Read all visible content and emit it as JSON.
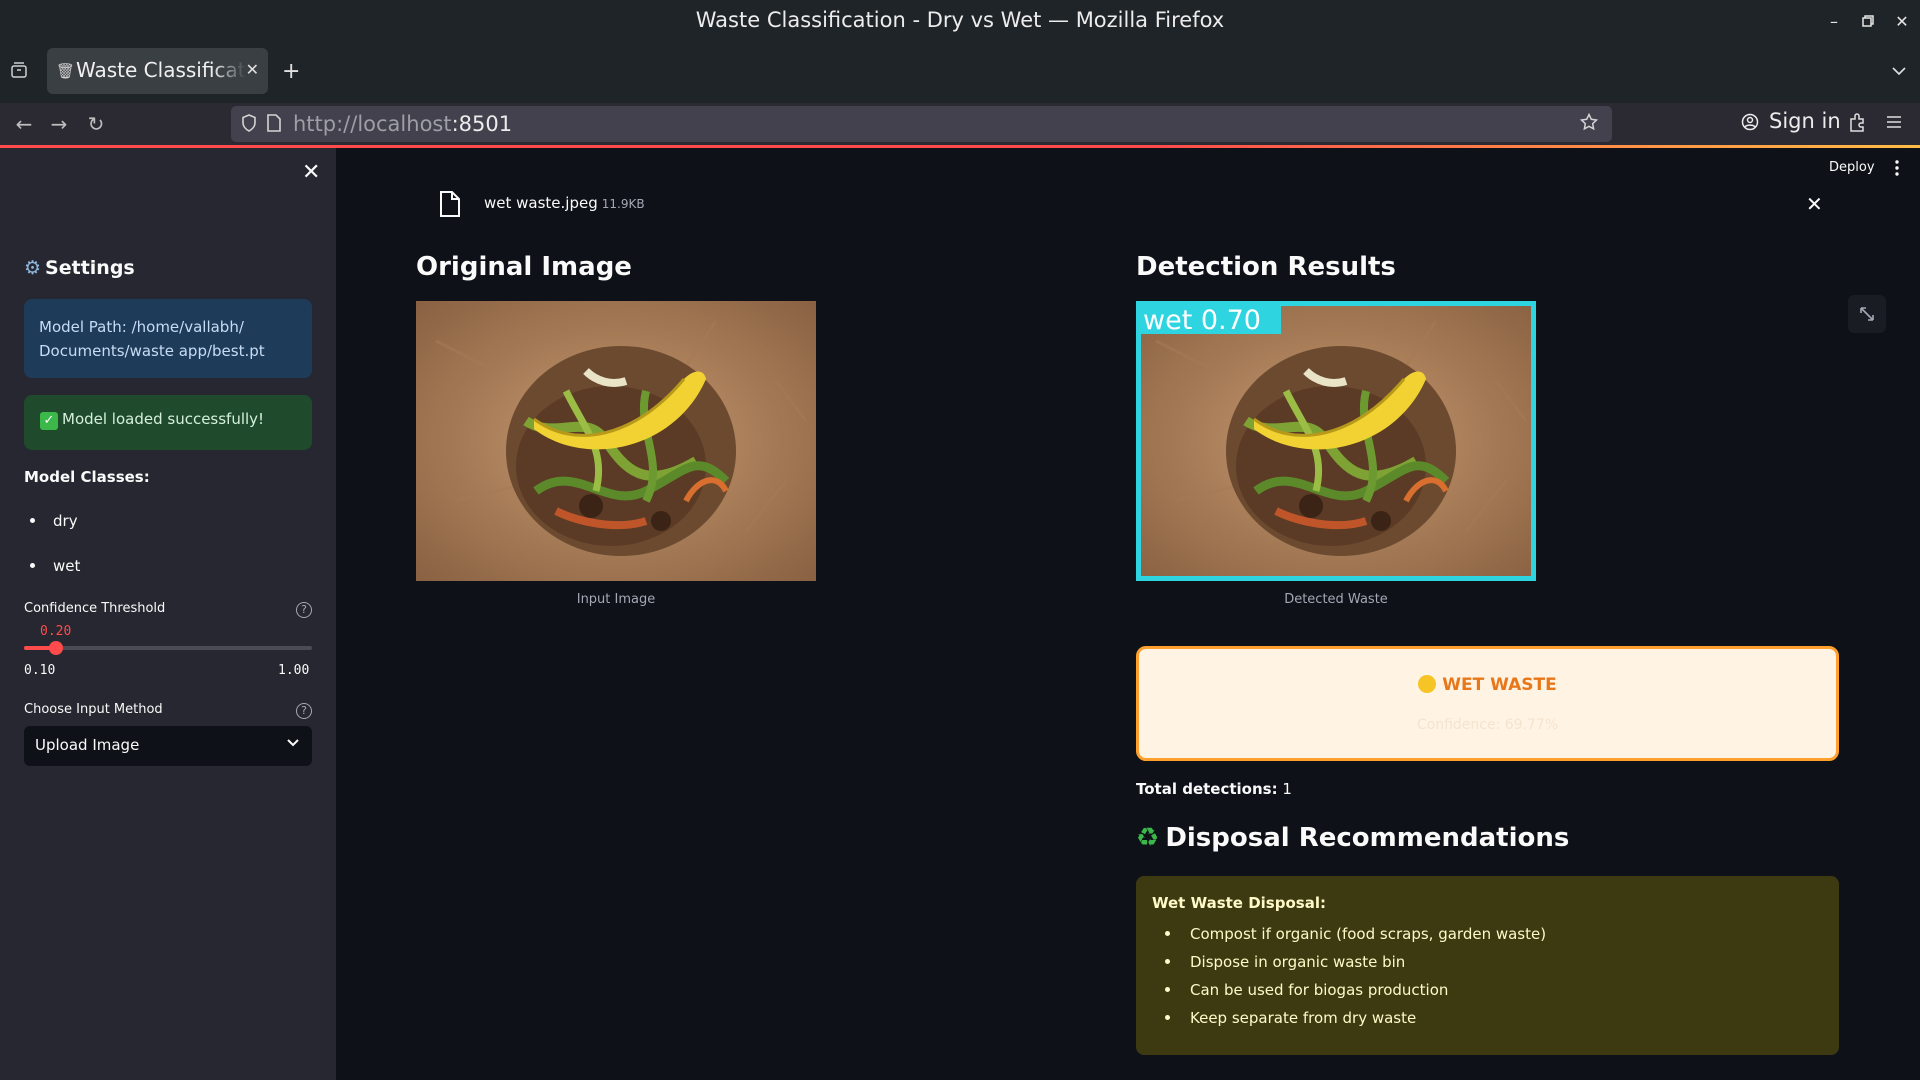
{
  "window": {
    "title": "Waste Classification - Dry vs Wet — Mozilla Firefox"
  },
  "browser": {
    "tab_title": "Waste Classification - Dry vs Wet",
    "url_host": "http://localhost",
    "url_port": ":8501",
    "sign_in": "Sign in"
  },
  "sidebar": {
    "heading": "Settings",
    "model_path": "Model Path: /home/vallabh/ Documents/waste app/best.pt",
    "success": "Model loaded successfully!",
    "classes_label": "Model Classes:",
    "classes": [
      "dry",
      "wet"
    ],
    "confidence_label": "Confidence Threshold",
    "confidence_value": "0.20",
    "confidence_min": "0.10",
    "confidence_max": "1.00",
    "confidence_fraction": 0.111,
    "input_method_label": "Choose Input Method",
    "input_method_value": "Upload Image"
  },
  "header": {
    "deploy": "Deploy"
  },
  "upload": {
    "filename": "wet waste.jpeg",
    "filesize": "11.9KB"
  },
  "original": {
    "heading": "Original Image",
    "caption": "Input Image"
  },
  "detection": {
    "heading": "Detection Results",
    "caption": "Detected Waste",
    "box_label": "wet 0.70",
    "result_title": "WET WASTE",
    "result_confidence": "Confidence: 69.77%",
    "total_label": "Total detections:",
    "total_value": "1"
  },
  "disposal": {
    "heading": "Disposal Recommendations",
    "box_title": "Wet Waste Disposal:",
    "items": [
      "Compost if organic (food scraps, garden waste)",
      "Dispose in organic waste bin",
      "Can be used for biogas production",
      "Keep separate from dry waste"
    ]
  },
  "colors": {
    "accent": "#ff4b4b",
    "bbox": "#2ed4e0",
    "result_border": "#ff9f2e"
  }
}
